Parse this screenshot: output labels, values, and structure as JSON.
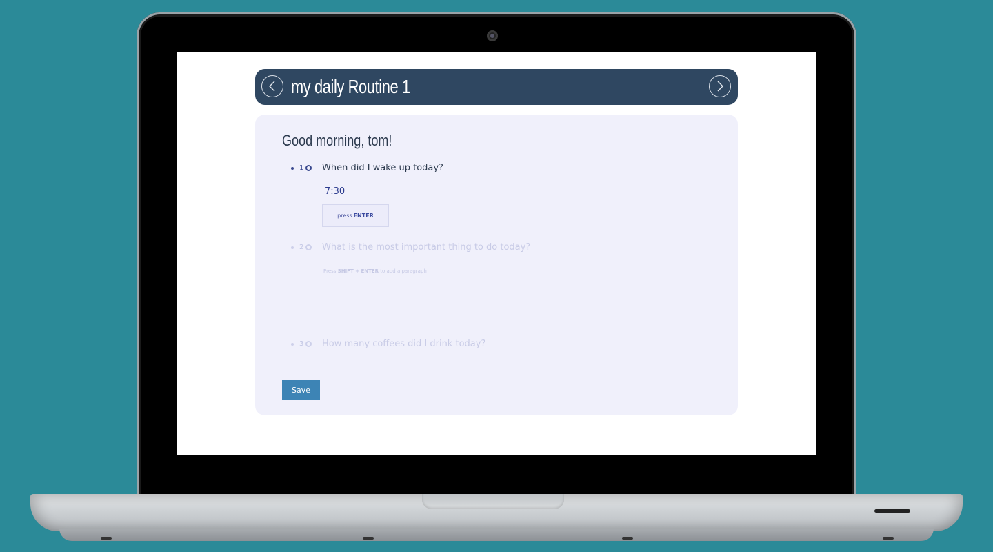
{
  "colors": {
    "background": "#2b8a98",
    "header": "#2f4761",
    "card": "#f0f0fb",
    "accent": "#3d84b5"
  },
  "header": {
    "title": "my daily Routine 1",
    "prev_icon": "chevron-left-icon",
    "next_icon": "chevron-right-icon"
  },
  "routine": {
    "greeting": "Good morning, tom!",
    "questions": [
      {
        "number": "1",
        "text": "When did I wake up today?",
        "answer": "7:30",
        "state": "active"
      },
      {
        "number": "2",
        "text": "What is the most important thing to do today?",
        "state": "upcoming"
      },
      {
        "number": "3",
        "text": "How many coffees did I drink today?",
        "state": "upcoming"
      }
    ],
    "enter_button": {
      "prefix": "press",
      "key": "ENTER"
    },
    "paragraph_hint": {
      "prefix": "Press",
      "keys": "SHIFT + ENTER",
      "suffix": "to add a paragraph"
    },
    "save_label": "Save"
  }
}
